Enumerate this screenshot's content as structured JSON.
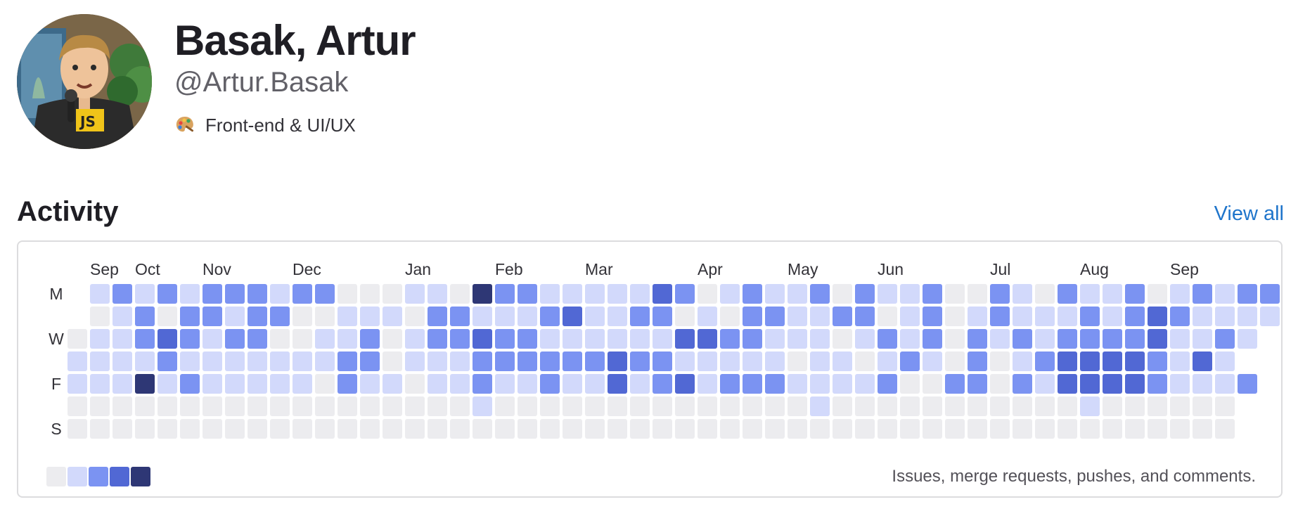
{
  "profile": {
    "name": "Basak, Artur",
    "handle": "@Artur.Basak",
    "bio_icon": "artist-palette-icon",
    "bio": "Front-end & UI/UX"
  },
  "activity": {
    "title": "Activity",
    "view_all": "View all",
    "note": "Issues, merge requests, pushes, and comments.",
    "months": [
      {
        "label": "Sep",
        "week": 1
      },
      {
        "label": "Oct",
        "week": 3
      },
      {
        "label": "Nov",
        "week": 6
      },
      {
        "label": "Dec",
        "week": 10
      },
      {
        "label": "Jan",
        "week": 15
      },
      {
        "label": "Feb",
        "week": 19
      },
      {
        "label": "Mar",
        "week": 23
      },
      {
        "label": "Apr",
        "week": 28
      },
      {
        "label": "May",
        "week": 32
      },
      {
        "label": "Jun",
        "week": 36
      },
      {
        "label": "Jul",
        "week": 41
      },
      {
        "label": "Aug",
        "week": 45
      },
      {
        "label": "Sep",
        "week": 49
      }
    ],
    "days": [
      {
        "label": "M",
        "row": 0
      },
      {
        "label": "W",
        "row": 2
      },
      {
        "label": "F",
        "row": 4
      },
      {
        "label": "S",
        "row": 6
      }
    ],
    "levels": [
      "#ececef",
      "#d2d9fb",
      "#7b93f2",
      "#5168d4",
      "#2e3775"
    ],
    "contribution_levels": [
      "-12121222122000110422111113201211202112002102112012122",
      "-01202212200111022111231122010221122012012111212321111",
      "01123212200112012232211111133221110121202121222231121",
      "1111211111112201112222223221111101101210201233332131-",
      "11141211111021101121121131231222111120022021333321112-",
      "0000000000000000001000000000000001000000000001000000-",
      "0000000000000000000000000000000000000000000000000000-"
    ]
  }
}
